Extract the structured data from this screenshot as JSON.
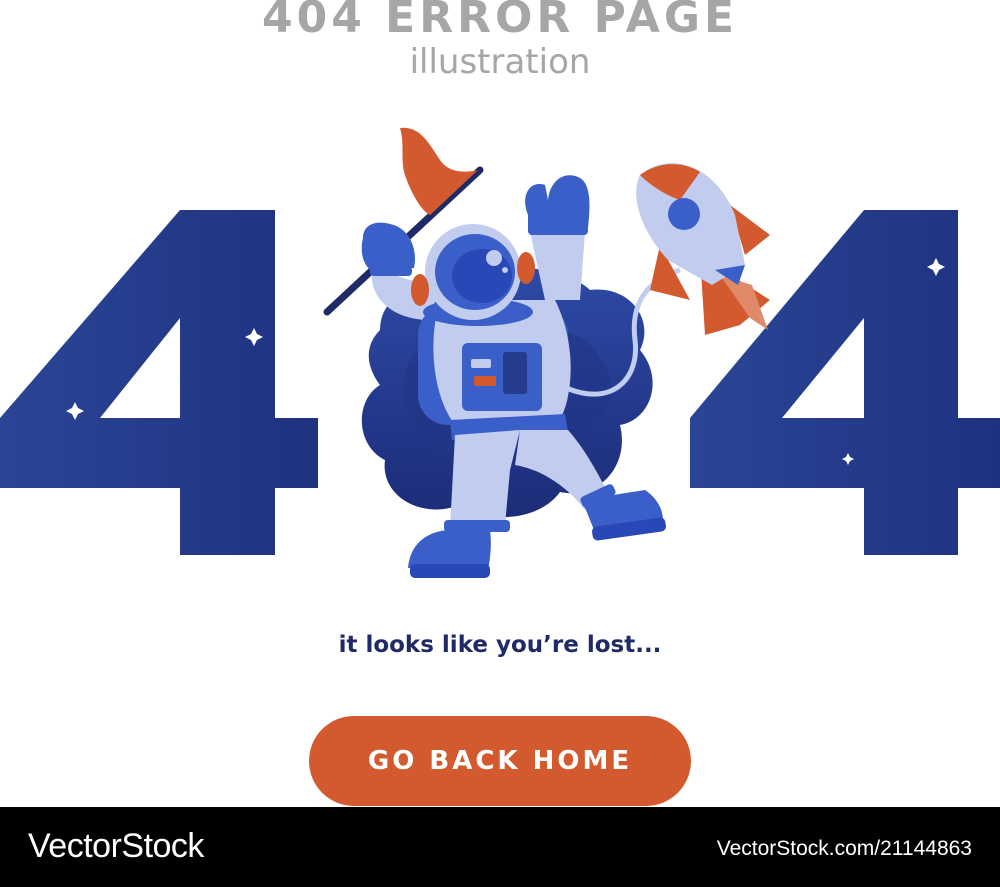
{
  "header": {
    "title": "404 ERROR PAGE",
    "subtitle": "illustration"
  },
  "message": "it looks like you’re lost...",
  "button": {
    "label": "GO BACK HOME"
  },
  "footer": {
    "watermark": "VectorStock",
    "image_id": "VectorStock.com/21144863"
  },
  "colors": {
    "digit_blue": "#243b8e",
    "astronaut_suit": "#c2ccee",
    "accent_blue": "#3a5fc8",
    "flag_orange": "#d35a2e",
    "button_orange": "#d35a2e",
    "text_navy": "#1f2a66",
    "header_gray": "#a6a6a6"
  },
  "icons": [
    "astronaut-illustration",
    "rocket-icon",
    "flag-icon",
    "sparkle-star-icon"
  ]
}
